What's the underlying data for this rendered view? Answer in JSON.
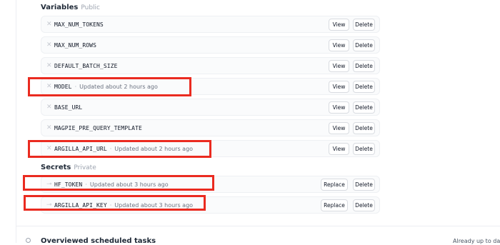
{
  "variables": {
    "title": "Variables",
    "subtitle": "Public",
    "view_label": "View",
    "delete_label": "Delete",
    "items": [
      {
        "name": "MAX_NUM_TOKENS",
        "updated": ""
      },
      {
        "name": "MAX_NUM_ROWS",
        "updated": ""
      },
      {
        "name": "DEFAULT_BATCH_SIZE",
        "updated": ""
      },
      {
        "name": "MODEL",
        "updated": "Updated about 2 hours ago"
      },
      {
        "name": "BASE_URL",
        "updated": ""
      },
      {
        "name": "MAGPIE_PRE_QUERY_TEMPLATE",
        "updated": ""
      },
      {
        "name": "ARGILLA_API_URL",
        "updated": "Updated about 2 hours ago"
      }
    ]
  },
  "secrets": {
    "title": "Secrets",
    "subtitle": "Private",
    "replace_label": "Replace",
    "delete_label": "Delete",
    "items": [
      {
        "name": "HF_TOKEN",
        "updated": "Updated about 3 hours ago"
      },
      {
        "name": "ARGILLA_API_KEY",
        "updated": "Updated about 3 hours ago"
      }
    ]
  },
  "next_section": {
    "title": "Overviewed scheduled tasks",
    "status": "Already up to date"
  },
  "colors": {
    "highlight": "#ea2b20",
    "row_background": "#fafbfc"
  },
  "icons": {
    "variable": "close-x-icon",
    "secret": "key-icon"
  }
}
